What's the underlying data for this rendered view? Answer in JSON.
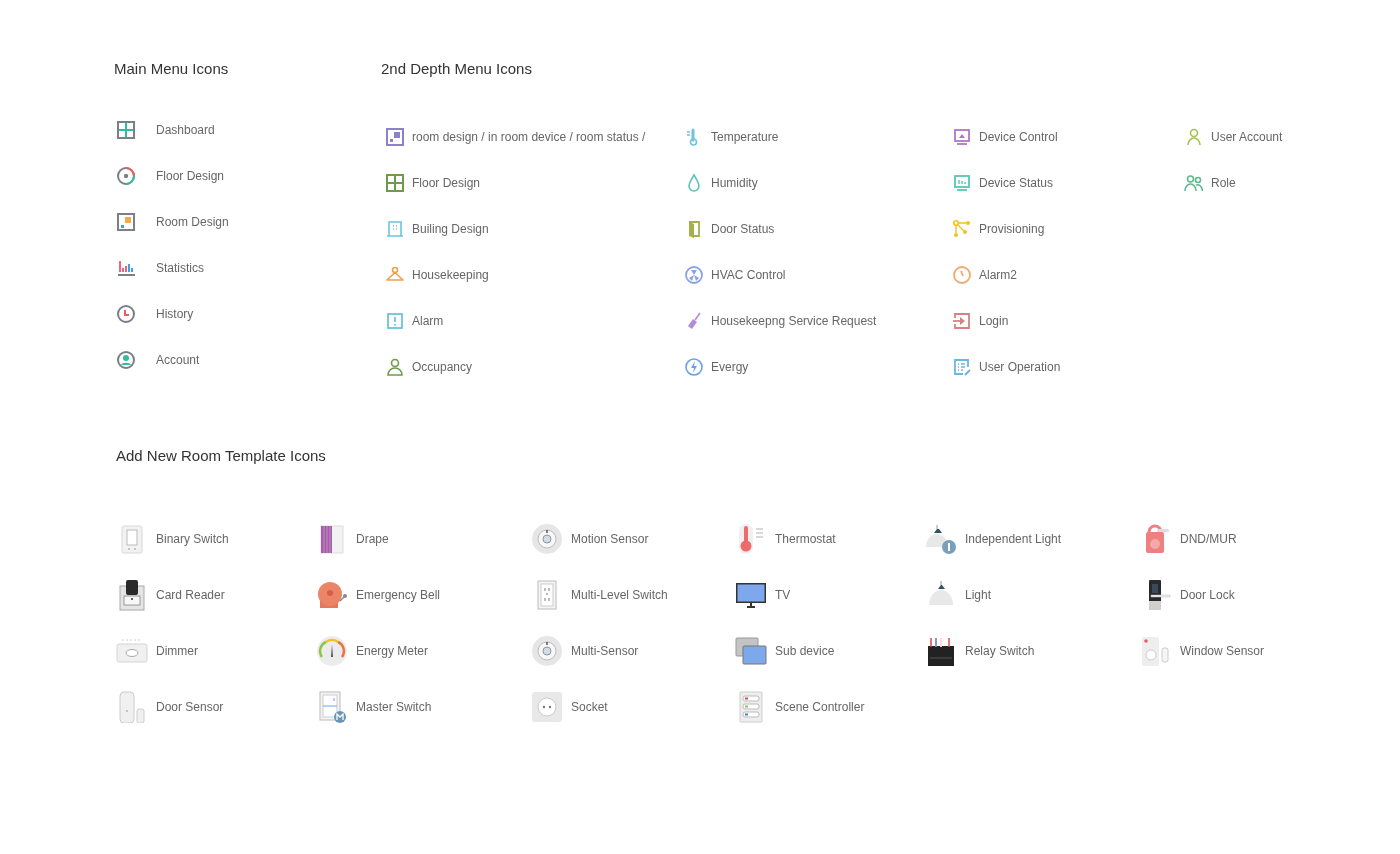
{
  "main_menu": {
    "title": "Main Menu Icons",
    "items": [
      {
        "label": "Dashboard"
      },
      {
        "label": "Floor Design"
      },
      {
        "label": "Room Design"
      },
      {
        "label": "Statistics"
      },
      {
        "label": "History"
      },
      {
        "label": "Account"
      }
    ]
  },
  "depth_menu": {
    "title": "2nd Depth Menu Icons",
    "columns": [
      [
        {
          "label": "room design / in room device / room status /"
        },
        {
          "label": "Floor Design"
        },
        {
          "label": "Builing Design"
        },
        {
          "label": "Housekeeping"
        },
        {
          "label": "Alarm"
        },
        {
          "label": "Occupancy"
        }
      ],
      [
        {
          "label": "Temperature"
        },
        {
          "label": "Humidity"
        },
        {
          "label": "Door Status"
        },
        {
          "label": "HVAC Control"
        },
        {
          "label": "Housekeepng Service Request"
        },
        {
          "label": "Evergy"
        }
      ],
      [
        {
          "label": "Device Control"
        },
        {
          "label": "Device Status"
        },
        {
          "label": "Provisioning"
        },
        {
          "label": "Alarm2"
        },
        {
          "label": "Login"
        },
        {
          "label": "User Operation"
        }
      ],
      [
        {
          "label": "User Account"
        },
        {
          "label": "Role"
        }
      ]
    ]
  },
  "room_template": {
    "title": "Add New Room Template Icons",
    "items": [
      {
        "label": "Binary Switch"
      },
      {
        "label": "Drape"
      },
      {
        "label": "Motion Sensor"
      },
      {
        "label": "Thermostat"
      },
      {
        "label": "Independent Light"
      },
      {
        "label": "DND/MUR"
      },
      {
        "label": "Card Reader"
      },
      {
        "label": "Emergency Bell"
      },
      {
        "label": "Multi-Level Switch"
      },
      {
        "label": "TV"
      },
      {
        "label": "Light"
      },
      {
        "label": "Door Lock"
      },
      {
        "label": "Dimmer"
      },
      {
        "label": "Energy Meter"
      },
      {
        "label": "Multi-Sensor"
      },
      {
        "label": "Sub device"
      },
      {
        "label": "Relay Switch"
      },
      {
        "label": "Window Sensor"
      },
      {
        "label": "Door Sensor"
      },
      {
        "label": "Master Switch"
      },
      {
        "label": "Socket"
      },
      {
        "label": "Scene Controller"
      }
    ]
  }
}
